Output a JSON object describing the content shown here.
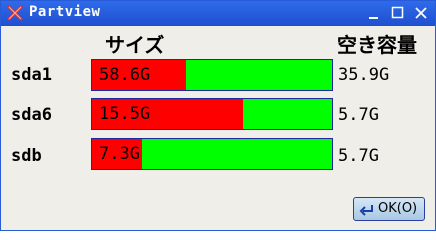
{
  "window": {
    "title": "Partview",
    "minimize_glyph": "_",
    "maximize_glyph": "□",
    "close_glyph": "✕"
  },
  "headers": {
    "size": "サイズ",
    "free": "空き容量"
  },
  "partitions": [
    {
      "name": "sda1",
      "size": "58.6G",
      "free": "35.9G",
      "used_fraction": 0.39
    },
    {
      "name": "sda6",
      "size": "15.5G",
      "free": "5.7G",
      "used_fraction": 0.63
    },
    {
      "name": "sdb",
      "size": "7.3G",
      "free": "5.7G",
      "used_fraction": 0.21
    }
  ],
  "ok_button": {
    "label": "OK(O)"
  },
  "colors": {
    "used": "#ff0000",
    "free": "#00ff00",
    "titlebar": "#2e6bea"
  }
}
